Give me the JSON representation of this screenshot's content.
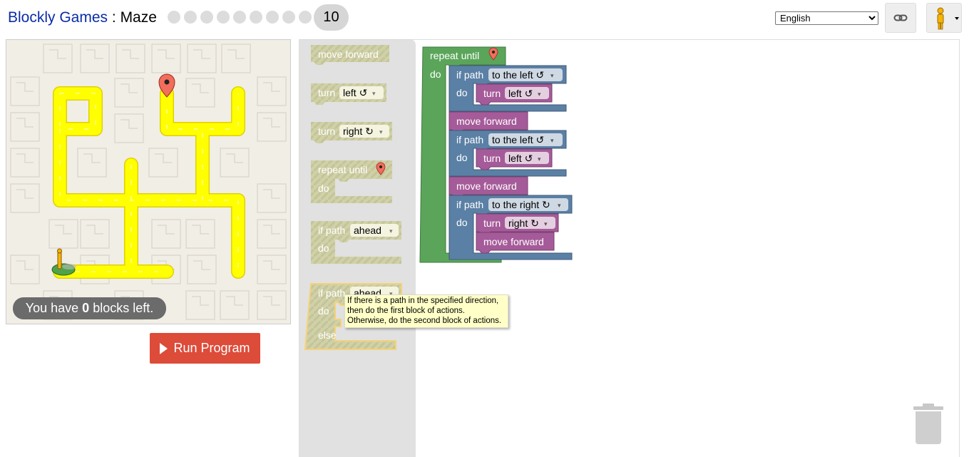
{
  "header": {
    "app_title": "Blockly Games",
    "separator": " : ",
    "game_title": "Maze",
    "levels_completed_dots": 9,
    "current_level": "10",
    "language": {
      "selected": "English"
    },
    "link_icon": "link-icon",
    "avatar_icon": "pegman-icon"
  },
  "maze": {
    "capacity_prefix": "You have ",
    "capacity_count": "0",
    "capacity_suffix": " blocks left.",
    "run_button": "Run Program"
  },
  "toolbox": {
    "move_forward": "move forward",
    "turn": "turn",
    "left": "left ↺",
    "right": "right ↻",
    "repeat_until": "repeat until",
    "do": "do",
    "if_path": "if path",
    "ahead": "ahead",
    "else": "else"
  },
  "program": {
    "repeat_until": "repeat until",
    "do": "do",
    "if_path": "if path",
    "to_the_left": "to the left ↺",
    "to_the_right": "to the right ↻",
    "turn": "turn",
    "left": "left ↺",
    "right": "right ↻",
    "move_forward": "move forward"
  },
  "tooltip": {
    "line1": "If there is a path in the specified direction,",
    "line2": "then do the first block of actions.",
    "line3": "Otherwise, do the second block of actions."
  },
  "colors": {
    "path": "#ffff00",
    "loop_block": "#5ba55b",
    "logic_block": "#5b80a5",
    "movement_block": "#a55b99",
    "run_button": "#dd4b39"
  }
}
